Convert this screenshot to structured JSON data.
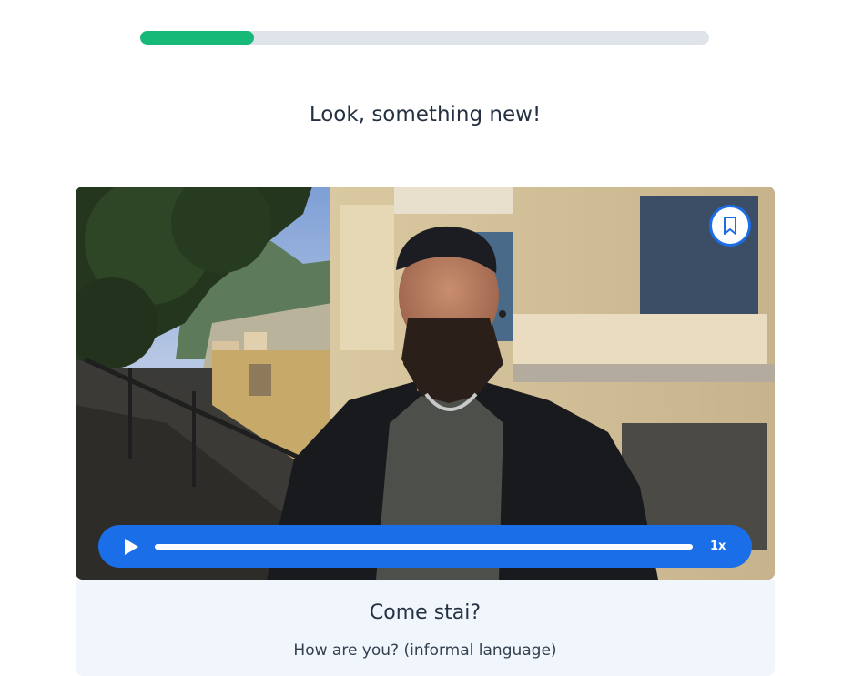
{
  "progress": {
    "value": 0.2
  },
  "lesson": {
    "heading": "Look, something new!"
  },
  "video": {
    "bookmark_icon": "bookmark-icon",
    "play_icon": "play-icon",
    "speed_label": "1x",
    "playback_progress": 0
  },
  "caption": {
    "phrase": "Come stai?",
    "translation": "How are you? (informal language)"
  },
  "colors": {
    "progress_fill": "#17b978",
    "progress_track": "#dfe3ea",
    "player_bar": "#1a6fe8",
    "caption_bg": "#f1f6fd"
  }
}
